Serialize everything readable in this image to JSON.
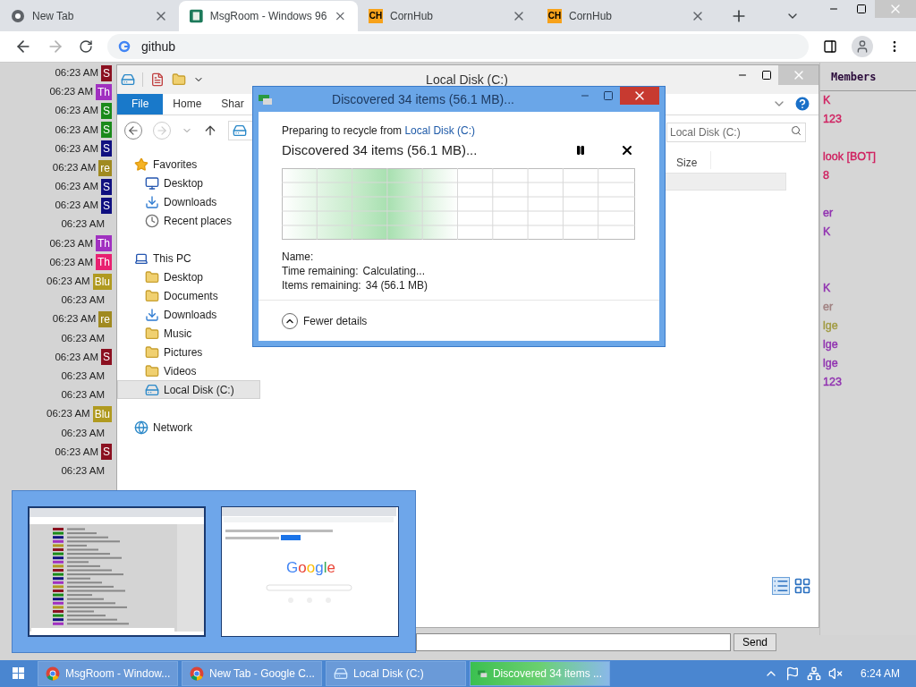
{
  "browser": {
    "tabs": [
      {
        "label": "New Tab",
        "selected": false,
        "kind": "chrome"
      },
      {
        "label": "MsgRoom - Windows 96",
        "selected": true,
        "kind": "app"
      },
      {
        "label": "CornHub",
        "selected": false,
        "kind": "logo",
        "logo": "CH"
      },
      {
        "label": "CornHub",
        "selected": false,
        "kind": "logo",
        "logo": "CH"
      }
    ],
    "address": "github"
  },
  "chat": {
    "rows": [
      {
        "time": "06:23 AM",
        "user": "S",
        "color": "#8b1020"
      },
      {
        "time": "06:23 AM",
        "user": "Th",
        "color": "#a030c0"
      },
      {
        "time": "06:23 AM",
        "user": "S",
        "color": "#1a8a1a"
      },
      {
        "time": "06:23 AM",
        "user": "S",
        "color": "#1a8a1a"
      },
      {
        "time": "06:23 AM",
        "user": "S",
        "color": "#101080"
      },
      {
        "time": "06:23 AM",
        "user": "re",
        "color": "#a08a20"
      },
      {
        "time": "06:23 AM",
        "user": "S",
        "color": "#101080"
      },
      {
        "time": "06:23 AM",
        "user": "S",
        "color": "#101080"
      },
      {
        "time": "06:23 AM"
      },
      {
        "time": "06:23 AM",
        "user": "Th",
        "color": "#a030c0"
      },
      {
        "time": "06:23 AM",
        "user": "Th",
        "color": "#e82070"
      },
      {
        "time": "06:23 AM",
        "user": "Blu",
        "color": "#b09a20"
      },
      {
        "time": "06:23 AM"
      },
      {
        "time": "06:23 AM",
        "user": "re",
        "color": "#a08a20"
      },
      {
        "time": "06:23 AM"
      },
      {
        "time": "06:23 AM",
        "user": "S",
        "color": "#8b1020"
      },
      {
        "time": "06:23 AM"
      },
      {
        "time": "06:23 AM"
      },
      {
        "time": "06:23 AM",
        "user": "Blu",
        "color": "#b09a20"
      },
      {
        "time": "06:23 AM"
      },
      {
        "time": "06:23 AM",
        "user": "S",
        "color": "#8b1020"
      },
      {
        "time": "06:23 AM"
      }
    ],
    "send": "Send"
  },
  "members": {
    "title": "Members",
    "items": [
      {
        "name": "K",
        "color": "#d02060"
      },
      {
        "name": "123",
        "color": "#d02060"
      },
      {
        "name": "look [BOT]",
        "color": "#d02060"
      },
      {
        "name": "8",
        "color": "#d02060"
      },
      {
        "name": "er",
        "color": "#9030b0"
      },
      {
        "name": "K",
        "color": "#9030b0"
      },
      {
        "name": "K",
        "color": "#9030b0"
      },
      {
        "name": "er",
        "color": "#a08080"
      },
      {
        "name": "lge",
        "color": "#a09a40"
      },
      {
        "name": "lge",
        "color": "#9030b0"
      },
      {
        "name": "lge",
        "color": "#9030b0"
      },
      {
        "name": "123",
        "color": "#9030b0"
      }
    ]
  },
  "explorer": {
    "title": "Local Disk (C:)",
    "ribbon_tabs": [
      {
        "label": "File",
        "selected": true
      },
      {
        "label": "Home",
        "selected": false
      },
      {
        "label": "Shar",
        "selected": false
      }
    ],
    "search_placeholder": "Local Disk (C:)",
    "column": "Size",
    "nav": [
      {
        "label": "Favorites",
        "kind": "star",
        "selected": false,
        "children": [
          {
            "label": "Desktop",
            "kind": "desktop",
            "selected": false
          },
          {
            "label": "Downloads",
            "kind": "download",
            "selected": false
          },
          {
            "label": "Recent places",
            "kind": "recent",
            "selected": false
          }
        ]
      },
      {
        "label": "This PC",
        "kind": "pc",
        "selected": false,
        "children": [
          {
            "label": "Desktop",
            "kind": "folder",
            "selected": false
          },
          {
            "label": "Documents",
            "kind": "folder",
            "selected": false
          },
          {
            "label": "Downloads",
            "kind": "download",
            "selected": false
          },
          {
            "label": "Music",
            "kind": "folder",
            "selected": false
          },
          {
            "label": "Pictures",
            "kind": "folder",
            "selected": false
          },
          {
            "label": "Videos",
            "kind": "folder",
            "selected": false
          },
          {
            "label": "Local Disk (C:)",
            "kind": "drive",
            "selected": true
          }
        ]
      },
      {
        "label": "Network",
        "kind": "network",
        "selected": false
      }
    ]
  },
  "dialog": {
    "title": "Discovered 34 items (56.1 MB)...",
    "prefix": "Preparing to recycle from",
    "source": "Local Disk (C:)",
    "heading": "Discovered 34 items (56.1 MB)...",
    "details": [
      {
        "label": "Name:"
      },
      {
        "label": "Time remaining:",
        "value": "Calculating..."
      },
      {
        "label": "Items remaining:",
        "value": "34 (56.1 MB)"
      }
    ],
    "toggle": "Fewer details",
    "expanded": true
  },
  "thumbnails": [
    {
      "kind": "chat",
      "selected": true
    },
    {
      "kind": "google",
      "selected": false,
      "logo": "Google"
    }
  ],
  "taskbar": {
    "items": [
      {
        "label": "MsgRoom - Window...",
        "kind": "chrome",
        "progress": false
      },
      {
        "label": "New Tab - Google C...",
        "kind": "chrome",
        "progress": false
      },
      {
        "label": "Local Disk (C:)",
        "kind": "drive",
        "progress": false
      },
      {
        "label": "Discovered 34 items ...",
        "kind": "recycle",
        "progress": true
      }
    ],
    "clock": "6:24 AM"
  }
}
